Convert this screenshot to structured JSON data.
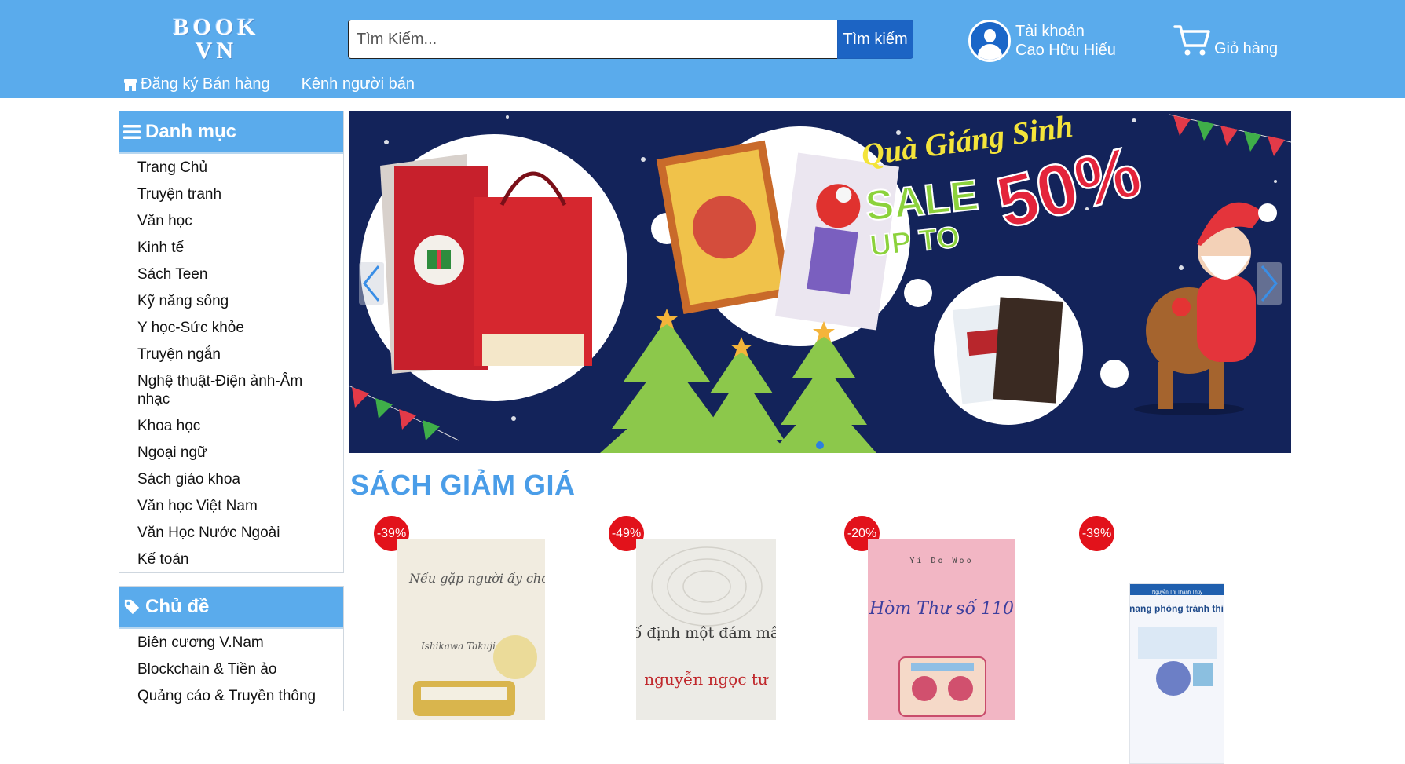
{
  "header": {
    "logo_line1": "BOOK",
    "logo_line2": "VN",
    "search_placeholder": "Tìm Kiếm...",
    "search_button": "Tìm kiếm",
    "account_label": "Tài khoản",
    "account_name": "Cao Hữu Hiếu",
    "cart_label": "Giỏ hàng",
    "brand_color": "#5aabec",
    "accent_color": "#1c64c4"
  },
  "subnav": {
    "register_seller": "Đăng ký Bán hàng",
    "seller_channel": "Kênh người bán",
    "register_icon": "shop-icon"
  },
  "categories": {
    "title": "Danh mục",
    "icon": "menu-icon",
    "items": [
      "Trang Chủ",
      "Truyện tranh",
      "Văn học",
      "Kinh tế",
      "Sách Teen",
      "Kỹ năng sống",
      "Y học-Sức khỏe",
      "Truyện ngắn",
      "Nghệ thuật-Điện ảnh-Âm nhạc",
      "Khoa học",
      "Ngoại ngữ",
      "Sách giáo khoa",
      "Văn học Việt Nam",
      "Văn Học Nước Ngoài",
      "Kế toán"
    ]
  },
  "topics": {
    "title": "Chủ đề",
    "icon": "tag-icon",
    "items": [
      "Biên cương V.Nam",
      "Blockchain & Tiền ảo",
      "Quảng cáo & Truyền thông"
    ]
  },
  "banner": {
    "headline": "Quà Giáng Sinh",
    "sale_line1": "SALE",
    "sale_line2": "UP TO",
    "sale_percent": "50%",
    "active_slide": 1
  },
  "section": {
    "title": "SÁCH GIẢM GIÁ"
  },
  "products": [
    {
      "discount": "-39%",
      "cover_color": "#f1ece0",
      "cover_text": "Nếu gặp người ấy cho tôi gửi lời chào",
      "cover_author": "Ishikawa Takuji"
    },
    {
      "discount": "-49%",
      "cover_color": "#ecebe6",
      "cover_text": "cố định một đám mây",
      "cover_author": "nguyễn ngọc tư"
    },
    {
      "discount": "-20%",
      "cover_color": "#f2b6c4",
      "cover_text": "Hòm Thư số 110",
      "cover_author": "Yi Do Woo"
    },
    {
      "discount": "-39%",
      "cover_color": "#f4f6fb",
      "cover_text": "Cẩm nang phòng tránh thiên tai",
      "cover_author": "Nguyễn Thị Thanh Thủy"
    }
  ]
}
